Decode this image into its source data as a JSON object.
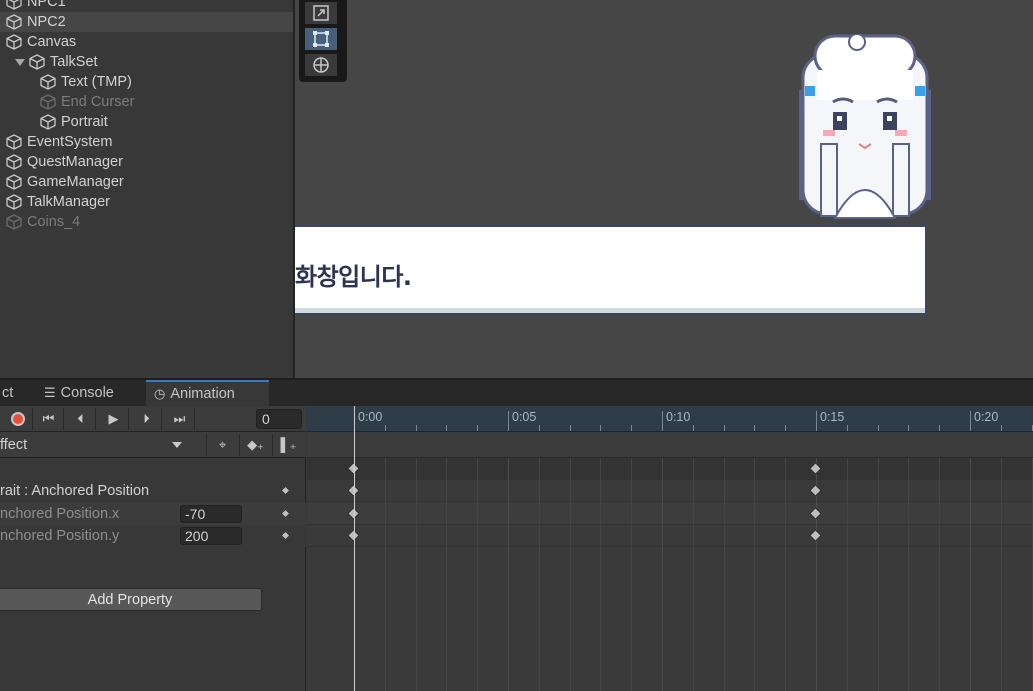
{
  "hierarchy": {
    "items": [
      {
        "label": "NPC1",
        "indent": 0,
        "disabled": false,
        "expanded": false,
        "has_children": false
      },
      {
        "label": "NPC2",
        "indent": 0,
        "disabled": false,
        "expanded": false,
        "has_children": false,
        "selected": true
      },
      {
        "label": "Canvas",
        "indent": 0,
        "disabled": false,
        "has_children": false
      },
      {
        "label": "TalkSet",
        "indent": 1,
        "disabled": false,
        "expanded": true,
        "has_children": true
      },
      {
        "label": "Text (TMP)",
        "indent": 2,
        "disabled": false
      },
      {
        "label": "End Curser",
        "indent": 2,
        "disabled": true
      },
      {
        "label": "Portrait",
        "indent": 2,
        "disabled": false
      },
      {
        "label": "EventSystem",
        "indent": 0,
        "disabled": false
      },
      {
        "label": "QuestManager",
        "indent": 0,
        "disabled": false
      },
      {
        "label": "GameManager",
        "indent": 0,
        "disabled": false
      },
      {
        "label": "TalkManager",
        "indent": 0,
        "disabled": false
      },
      {
        "label": "Coins_4",
        "indent": 0,
        "disabled": true
      }
    ]
  },
  "scene": {
    "dialog_text": "화창입니다.",
    "tools": [
      "scale-tool-icon",
      "rect-tool-icon",
      "transform-tool-icon"
    ],
    "active_tool": "rect-tool-icon"
  },
  "tabs": [
    {
      "label": "ct",
      "icon": ""
    },
    {
      "label": "Console",
      "icon": "console-icon"
    },
    {
      "label": "Animation",
      "icon": "clock-icon",
      "active": true
    }
  ],
  "animation": {
    "current_frame": "0",
    "clip_name": "ffect",
    "properties": [
      {
        "label": "rait : Anchored Position",
        "value": null,
        "type": "group"
      },
      {
        "label": "nchored Position.x",
        "value": "-70",
        "type": "sub"
      },
      {
        "label": "nchored Position.y",
        "value": "200",
        "type": "sub"
      }
    ],
    "add_property_label": "Add Property",
    "ruler_labels": [
      "0:00",
      "0:05",
      "0:10",
      "0:15",
      "0:20"
    ],
    "keyframe_times_seconds": [
      0,
      15
    ]
  },
  "colors": {
    "accent_tab": "#3a79bb",
    "record": "#e8503a",
    "ruler_bg": "#2f3d48"
  }
}
